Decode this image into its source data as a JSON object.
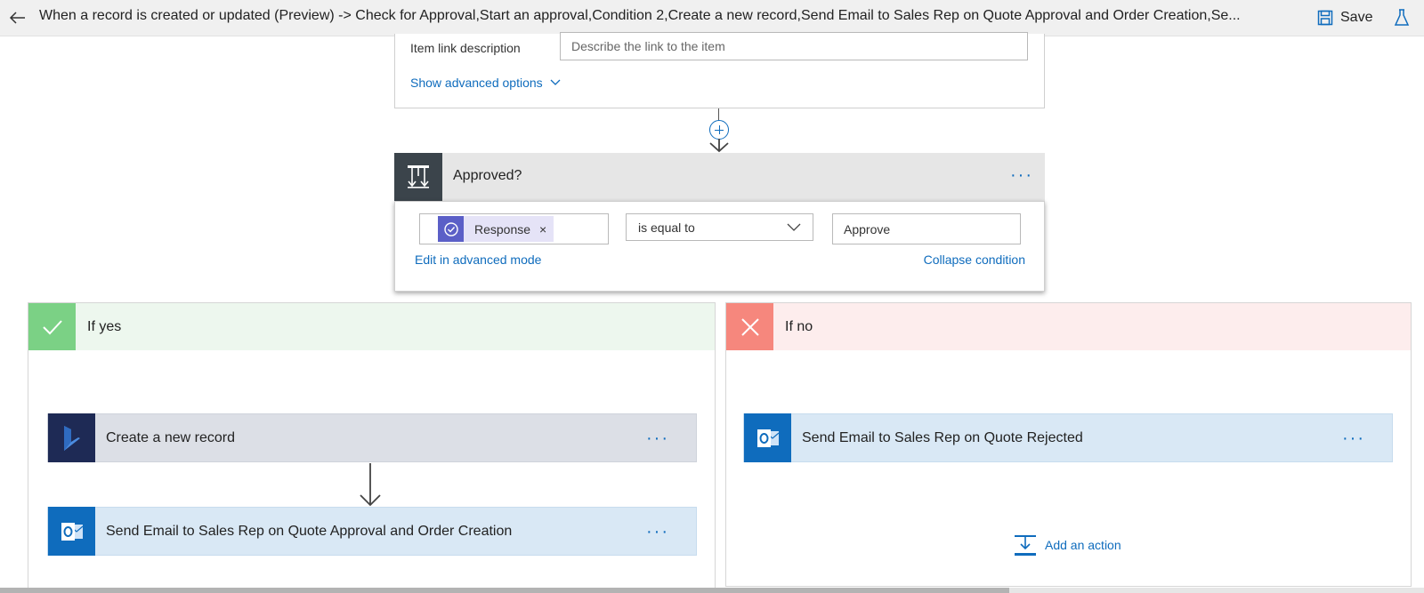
{
  "header": {
    "title": "When a record is created or updated (Preview) -> Check for Approval,Start an approval,Condition 2,Create a new record,Send Email to Sales Rep on Quote Approval and Order Creation,Se...",
    "save_label": "Save",
    "test_label": "T"
  },
  "top_card": {
    "item_link_label": "Item link description",
    "item_link_placeholder": "Describe the link to the item",
    "advanced_link": "Show advanced options"
  },
  "condition": {
    "title": "Approved?",
    "token_label": "Response",
    "token_remove": "×",
    "operator": "is equal to",
    "value": "Approve",
    "edit_advanced": "Edit in advanced mode",
    "collapse": "Collapse condition",
    "menu": "···"
  },
  "branch_yes": {
    "label": "If yes",
    "actions": [
      {
        "label": "Create a new record",
        "menu": "···"
      },
      {
        "label": "Send Email to Sales Rep on Quote Approval and Order Creation",
        "menu": "···"
      }
    ]
  },
  "branch_no": {
    "label": "If no",
    "actions": [
      {
        "label": "Send Email to Sales Rep on Quote Rejected",
        "menu": "···"
      }
    ],
    "add_action": "Add an action"
  },
  "colors": {
    "accent": "#0f6cbd",
    "yes_header": "#edf7ee",
    "yes_icon": "#7bd185",
    "no_header": "#fdeded",
    "no_icon": "#f6877d",
    "condition_icon": "#3b444b",
    "dynamics_icon": "#1e2a55",
    "outlook_icon": "#0f6cbd"
  }
}
